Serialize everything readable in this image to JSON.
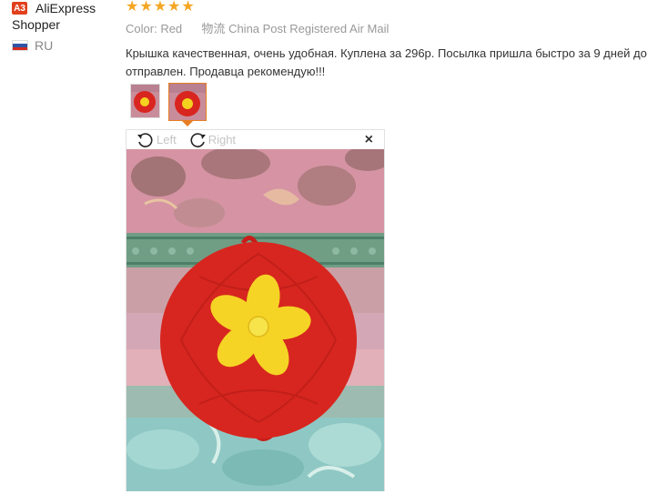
{
  "reviewer": {
    "badge": "A3",
    "name_line1": "AliExpress",
    "name_line2": "Shopper",
    "country_code": "RU",
    "flag_colors": [
      "#ffffff",
      "#2f55a4",
      "#d52b1e"
    ]
  },
  "review": {
    "rating": 5,
    "stars": [
      "★",
      "★",
      "★",
      "★",
      "★"
    ],
    "star_color": "#f5a623",
    "color_label": "Color:",
    "color_value": "Red",
    "logistics_label": "物流",
    "logistics_value": "China Post Registered Air Mail",
    "text": "Крышка качественная, очень удобная. Куплена за 296р. Посылка пришла быстро за 9 дней до отправлен. Продавца рекомендую!!!"
  },
  "viewer": {
    "rotate_left_label": "Left",
    "rotate_right_label": "Right",
    "close_symbol": "×",
    "accent_color": "#e87d22"
  }
}
